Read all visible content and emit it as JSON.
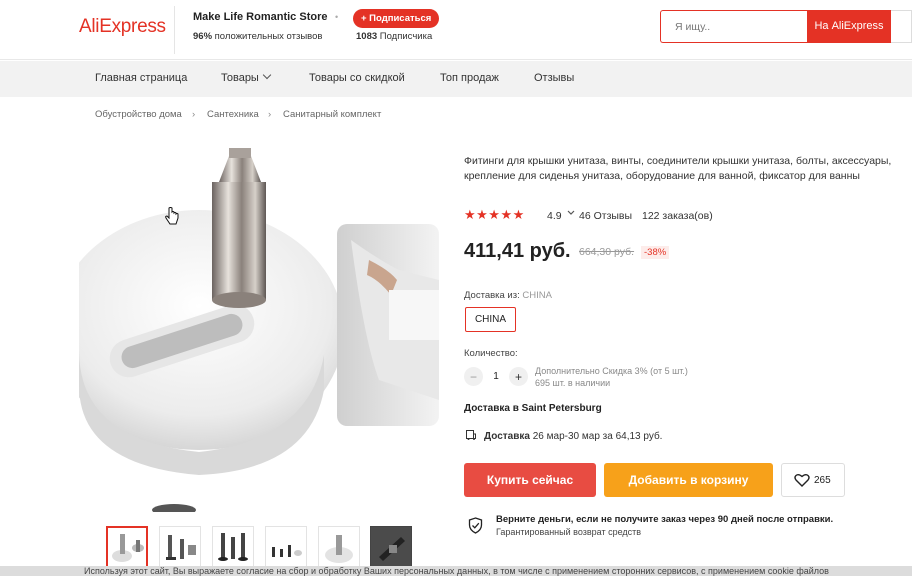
{
  "header": {
    "logo": "AliExpress",
    "store_name": "Make Life Romantic Store",
    "subscribe_label": "+ Подписаться",
    "rating_value": "96%",
    "rating_text": " положительных отзывов",
    "subscribers_count": "1083",
    "subscribers_text": " Подписчика",
    "search_placeholder": "Я ищу..",
    "search_button": "На AliExpress"
  },
  "nav": {
    "items": [
      {
        "label": "Главная страница"
      },
      {
        "label": "Товары"
      },
      {
        "label": "Товары со скидкой"
      },
      {
        "label": "Топ продаж"
      },
      {
        "label": "Отзывы"
      }
    ]
  },
  "breadcrumb": [
    "Обустройство дома",
    "Сантехника",
    "Санитарный комплект"
  ],
  "product": {
    "title": "Фитинги для крышки унитаза, винты, соединители крышки унитаза, болты, аксессуары, крепление для сиденья унитаза, оборудование для ванной, фиксатор для ванны",
    "rating": "4.9",
    "reviews": "46 Отзывы",
    "orders": "122 заказа(ов)",
    "price": "411,41 руб.",
    "old_price": "664,30 руб.",
    "discount": "-38%",
    "ship_from_label": "Доставка из:",
    "ship_from_value": "CHINA",
    "country_option": "CHINA",
    "quantity_label": "Количество:",
    "quantity_value": "1",
    "quantity_discount": "Дополнительно Скидка 3% (от 5 шт.)",
    "stock": "695 шт. в наличии",
    "delivery_to": "Доставка в Saint Petersburg",
    "delivery_label": "Доставка",
    "delivery_dates": " 26 мар-30 мар за 64,13 руб.",
    "buy_now": "Купить сейчас",
    "add_to_cart": "Добавить в корзину",
    "wishlist_count": "265",
    "guarantee_main": "Верните деньги, если не получите заказ через 90 дней после отправки.",
    "guarantee_sub": "Гарантированный возврат средств"
  },
  "cookie_bar": {
    "text": "Используя этот сайт, Вы выражаете согласие на сбор и обработку Ваших персональных данных, в том числе с применением сторонних сервисов, с применением cookie файлов"
  },
  "colors": {
    "accent": "#e43225",
    "buy_button": "#e84c42",
    "cart_button": "#f7a11a"
  }
}
